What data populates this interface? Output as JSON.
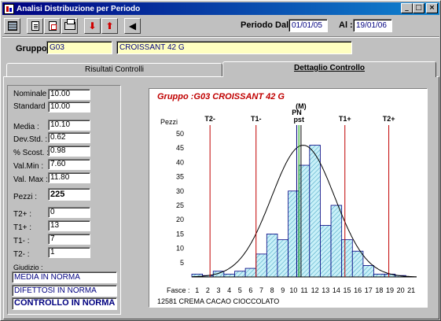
{
  "window": {
    "title": "Analisi Distribuzione per Periodo",
    "controls": {
      "minimize": "_",
      "maximize": "□",
      "close": "×"
    }
  },
  "toolbar": {
    "buttons": [
      {
        "name": "grid-view-icon"
      },
      {
        "name": "document-icon"
      },
      {
        "name": "report-icon"
      },
      {
        "name": "printer-icon"
      },
      {
        "name": "arrow-down-icon",
        "glyph": "⬇"
      },
      {
        "name": "arrow-up-icon",
        "glyph": "⬆"
      },
      {
        "name": "exit-icon",
        "glyph": "◀"
      }
    ]
  },
  "periodo": {
    "dal_label": "Periodo Dal :",
    "dal_value": "01/01/05",
    "al_label": "Al :",
    "al_value": "19/01/06"
  },
  "gruppo": {
    "label": "Gruppo :",
    "code": "G03",
    "description": "CROISSANT 42 G"
  },
  "tabs": [
    {
      "label": "Risultati Controlli",
      "active": false
    },
    {
      "label": "Dettaglio Controllo",
      "active": true
    }
  ],
  "stats": {
    "nominale": {
      "label": "Nominale :",
      "value": "10.00"
    },
    "standard": {
      "label": "Standard :",
      "value": "10.00"
    },
    "media": {
      "label": "Media :",
      "value": "10.10"
    },
    "dev_std": {
      "label": "Dev.Std. :",
      "value": "0.62"
    },
    "scost": {
      "label": "% Scost. :",
      "value": "0.98"
    },
    "val_min": {
      "label": "Val.Min :",
      "value": "7.60"
    },
    "val_max": {
      "label": "Val. Max :",
      "value": "11.80"
    },
    "pezzi": {
      "label": "Pezzi :",
      "value": "225"
    },
    "t2plus": {
      "label": "T2+ :",
      "value": "0"
    },
    "t1plus": {
      "label": "T1+ :",
      "value": "13"
    },
    "t1minus": {
      "label": "T1- :",
      "value": "7"
    },
    "t2minus": {
      "label": "T2- :",
      "value": "1"
    }
  },
  "giudizio": {
    "label": "Giudizio :",
    "lines": [
      "MEDIA IN NORMA",
      "DIFETTOSI IN NORMA",
      "CONTROLLO IN NORMA"
    ]
  },
  "chart_data": {
    "type": "bar",
    "title": "Gruppo :G03 CROISSANT 42 G",
    "ylabel": "Pezzi",
    "xlabel": "Fasce :",
    "footer": "12581 CREMA CACAO CIOCCOLATO",
    "categories": [
      1,
      2,
      3,
      4,
      5,
      6,
      7,
      8,
      9,
      10,
      11,
      12,
      13,
      14,
      15,
      16,
      17,
      18,
      19,
      20,
      21
    ],
    "values": [
      1,
      0.5,
      2,
      1,
      2,
      3,
      8,
      15,
      13,
      30,
      39,
      46,
      18,
      25,
      13,
      9,
      4,
      1,
      1,
      0.5,
      0
    ],
    "ylim": [
      0,
      50
    ],
    "yticks": [
      5,
      10,
      15,
      20,
      25,
      30,
      35,
      40,
      45,
      50
    ],
    "xlim": [
      0.5,
      21.5
    ],
    "markers": [
      {
        "label": "T2-",
        "x": 2.2,
        "color": "#c00000"
      },
      {
        "label": "T1-",
        "x": 6.5,
        "color": "#c00000"
      },
      {
        "label": "T1+",
        "x": 14.8,
        "color": "#c00000"
      },
      {
        "label": "T2+",
        "x": 18.9,
        "color": "#c00000"
      },
      {
        "label": "PN",
        "x": 10.3,
        "color": "#000080"
      },
      {
        "label": "pst",
        "x": 10.5,
        "color": "#00a000"
      },
      {
        "label": "(M)",
        "x": 10.7,
        "color": "#000000"
      }
    ],
    "curve": {
      "mean": 10.9,
      "sd": 2.95,
      "peak": 46
    },
    "bar_fill": "#c8f0f8",
    "bar_hatch": "#40a0c0",
    "bar_stroke": "#000080"
  }
}
